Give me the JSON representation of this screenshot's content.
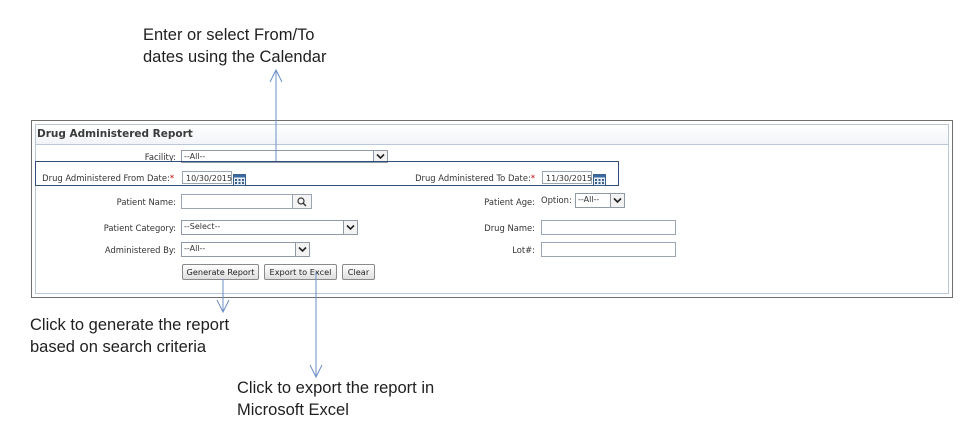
{
  "callouts": {
    "dates_line1": "Enter or select From/To",
    "dates_line2": "dates using the Calendar",
    "generate_line1": "Click to generate the report",
    "generate_line2": "based on search criteria",
    "export_line1": "Click to export the report in",
    "export_line2": "Microsoft Excel"
  },
  "panel": {
    "title": "Drug Administered Report"
  },
  "form": {
    "facility_label": "Facility:",
    "facility_value": "--All--",
    "from_date_label": "Drug Administered From Date:",
    "from_date_value": "10/30/2015",
    "to_date_label": "Drug Administered To Date:",
    "to_date_value": "11/30/2015",
    "required_mark": "*",
    "patient_name_label": "Patient Name:",
    "patient_name_value": "",
    "patient_age_label": "Patient Age:",
    "patient_age_option_label": "Option:",
    "patient_age_value": "--All--",
    "patient_category_label": "Patient Category:",
    "patient_category_value": "--Select--",
    "drug_name_label": "Drug Name:",
    "drug_name_value": "",
    "administered_by_label": "Administered By:",
    "administered_by_value": "--All--",
    "lot_label": "Lot#:",
    "lot_value": ""
  },
  "buttons": {
    "generate": "Generate Report",
    "export": "Export to Excel",
    "clear": "Clear"
  },
  "colors": {
    "arrow": "#6b8fc4",
    "required": "#d40000",
    "highlight_border": "#2f4f78"
  }
}
